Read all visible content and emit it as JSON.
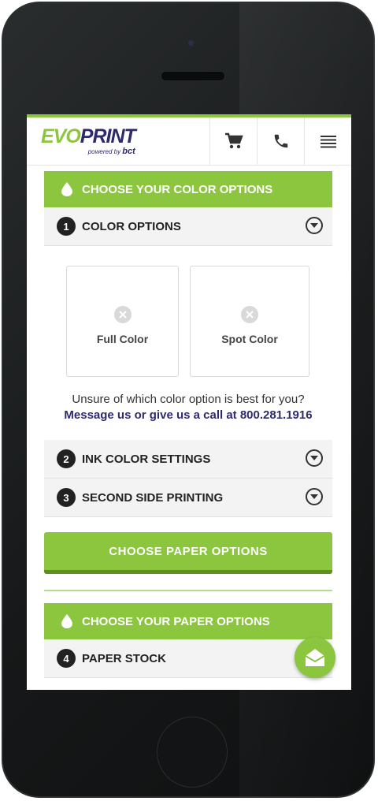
{
  "brand": {
    "logo_evo": "EVO",
    "logo_print": "PRINT",
    "powered_by": "powered by",
    "parent": "bct"
  },
  "header_icons": [
    "cart-icon",
    "phone-icon",
    "menu-icon"
  ],
  "colors": {
    "accent_green": "#8cc63f",
    "brand_navy": "#2d2a6e",
    "phone_body": "#1b1d1e"
  },
  "color_section": {
    "title": "CHOOSE YOUR COLOR OPTIONS",
    "steps": [
      {
        "number": "1",
        "label": "COLOR OPTIONS"
      },
      {
        "number": "2",
        "label": "INK COLOR SETTINGS"
      },
      {
        "number": "3",
        "label": "SECOND SIDE PRINTING"
      }
    ],
    "options": [
      {
        "label": "Full Color"
      },
      {
        "label": "Spot Color"
      }
    ],
    "help_text": "Unsure of which color option is best for you?",
    "help_link": "Message us or give us a call at 800.281.1916"
  },
  "cta": {
    "label": "CHOOSE PAPER OPTIONS"
  },
  "paper_section": {
    "title": "CHOOSE YOUR PAPER OPTIONS",
    "steps": [
      {
        "number": "4",
        "label": "PAPER STOCK"
      }
    ]
  }
}
